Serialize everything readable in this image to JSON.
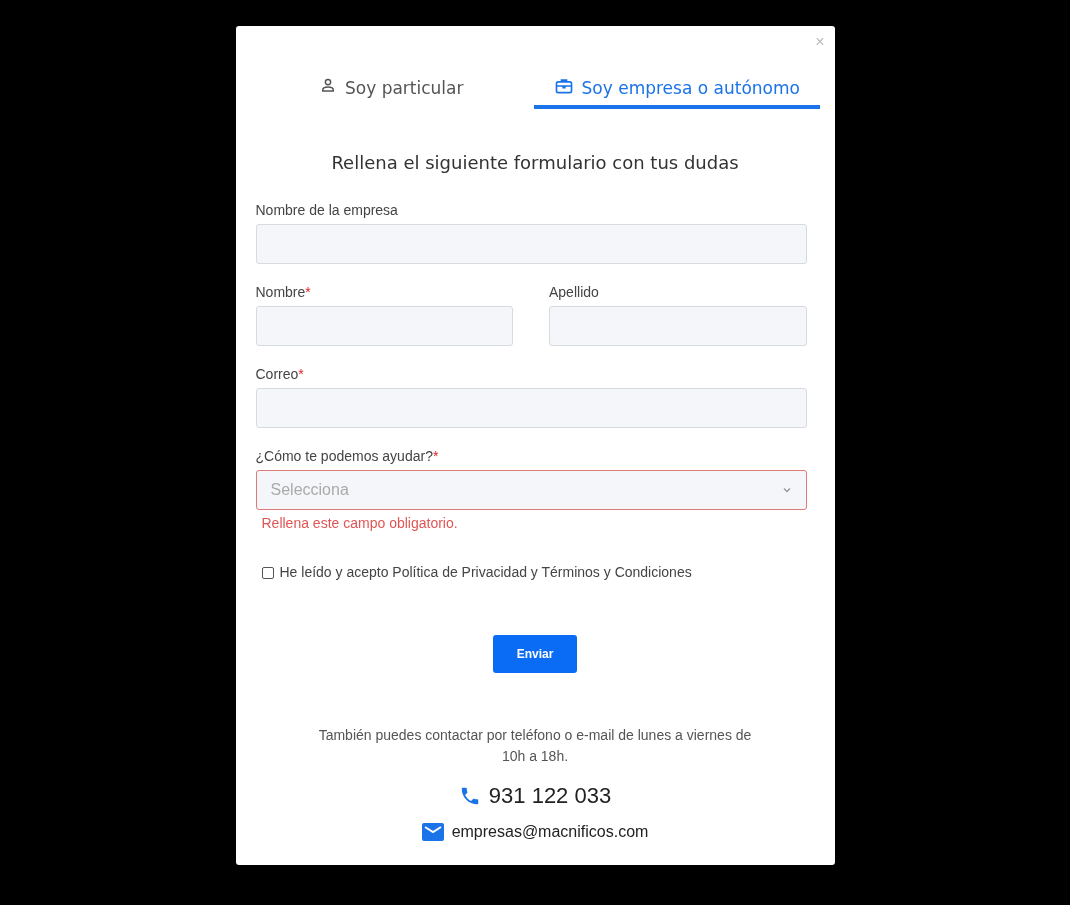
{
  "close": "×",
  "tabs": [
    {
      "label": "Soy particular",
      "kind": "person",
      "selected": false
    },
    {
      "label": "Soy empresa o autónomo",
      "kind": "briefcase",
      "selected": true
    }
  ],
  "heading": "Rellena el siguiente formulario con tus dudas",
  "rows": [
    [
      {
        "label": "Nombre de la empresa",
        "required": false,
        "kind": "text"
      }
    ],
    [
      {
        "label": "Nombre",
        "required": true,
        "kind": "text"
      },
      {
        "label": "Apellido",
        "required": false,
        "kind": "text"
      }
    ],
    [
      {
        "label": "Correo",
        "required": true,
        "kind": "text"
      }
    ],
    [
      {
        "label": "¿Cómo te podemos ayudar?",
        "required": true,
        "kind": "select",
        "placeholder": "Selecciona",
        "invalid": true,
        "error": "Rellena este campo obligatorio."
      }
    ]
  ],
  "required_mark": "*",
  "consent": {
    "label": "He leído y acepto Política de Privacidad y Términos y Condiciones",
    "checked": false
  },
  "submit": "Enviar",
  "contact_note": "También puedes contactar por teléfono o e-mail de lunes a viernes de 10h a 18h.",
  "phone": "931 122 033",
  "email": "empresas@macnificos.com"
}
